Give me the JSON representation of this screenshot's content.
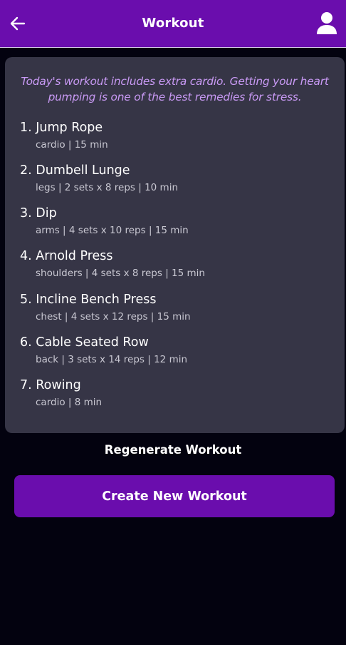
{
  "header": {
    "title": "Workout",
    "back_icon": "arrow-left-icon",
    "profile_icon": "user-icon"
  },
  "workout": {
    "intro": "Today's workout includes extra cardio. Getting your heart pumping is one of the best remedies for stress.",
    "exercises": [
      {
        "name": "1. Jump Rope",
        "detail": "cardio | 15 min"
      },
      {
        "name": "2. Dumbell Lunge",
        "detail": "legs | 2 sets x 8 reps | 10 min"
      },
      {
        "name": "3. Dip",
        "detail": "arms | 4 sets x 10 reps | 15 min"
      },
      {
        "name": "4. Arnold Press",
        "detail": "shoulders | 4 sets x 8 reps | 15 min"
      },
      {
        "name": "5. Incline Bench Press",
        "detail": "chest | 4 sets x 12 reps | 15 min"
      },
      {
        "name": "6. Cable Seated Row",
        "detail": "back | 3 sets x 14 reps | 12 min"
      },
      {
        "name": "7. Rowing",
        "detail": "cardio | 8 min"
      }
    ]
  },
  "actions": {
    "regenerate_label": "Regenerate Workout",
    "create_label": "Create New Workout"
  },
  "colors": {
    "accent": "#6a0dad",
    "background": "#03020f",
    "card": "#363546",
    "intro_text": "#c99af5"
  }
}
